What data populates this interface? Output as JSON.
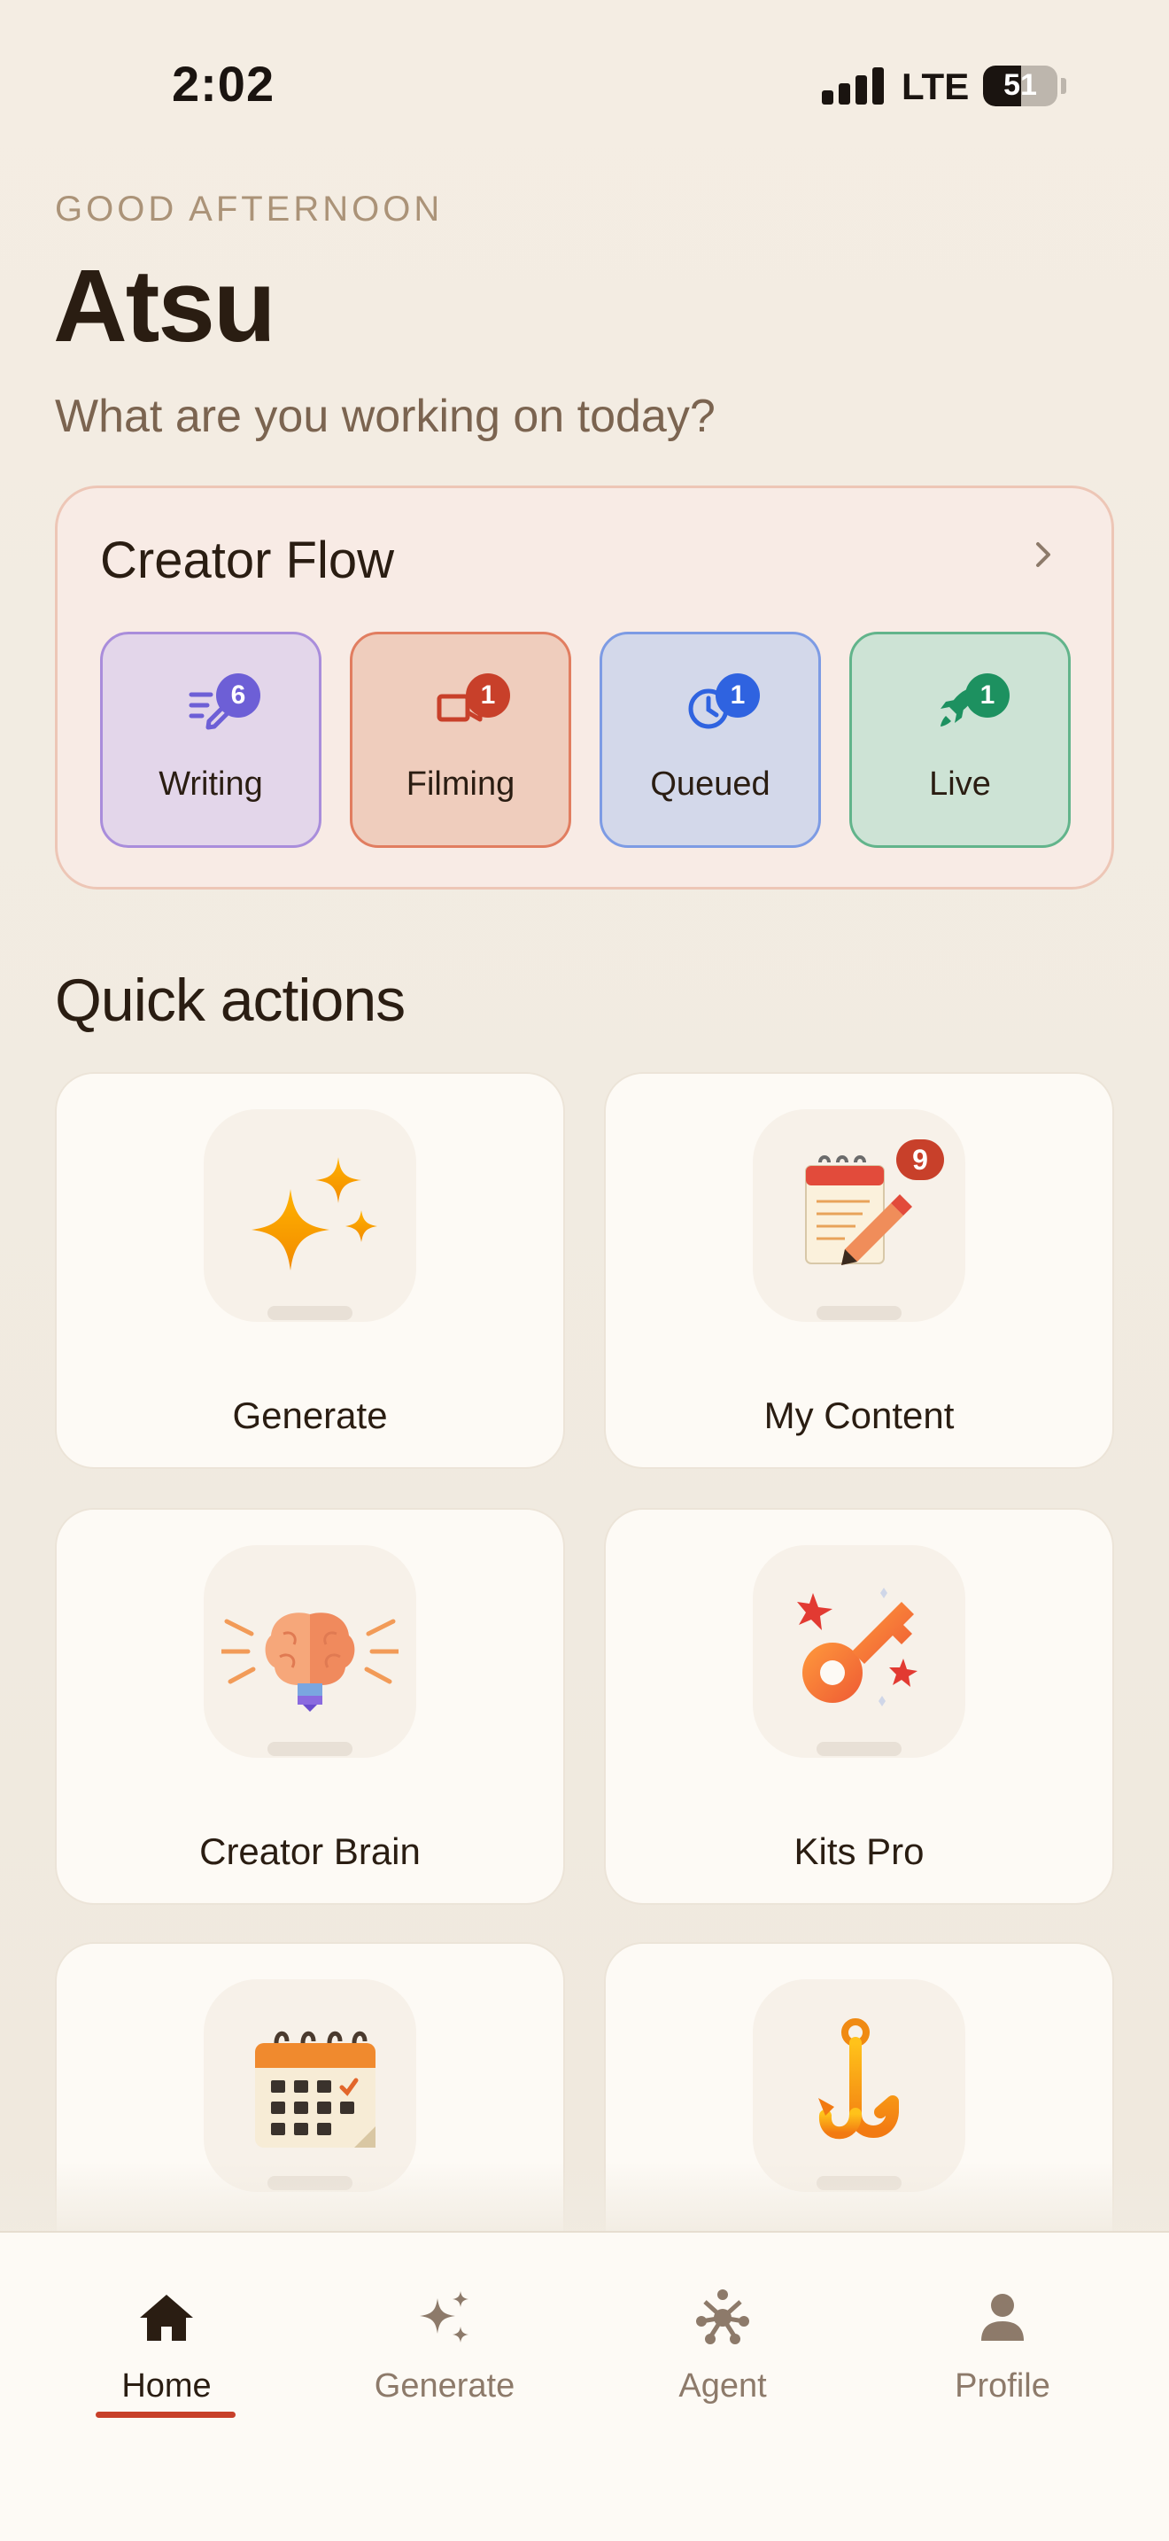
{
  "status_bar": {
    "time": "2:02",
    "network": "LTE",
    "battery_percent": "51",
    "battery_level": 0.51
  },
  "header": {
    "eyebrow": "GOOD AFTERNOON",
    "name": "Atsu",
    "subtitle": "What are you working on today?"
  },
  "creator_flow": {
    "title": "Creator Flow",
    "stages": [
      {
        "label": "Writing",
        "count": "6",
        "icon": "writing-icon",
        "bg": "#e3d6ea",
        "border": "#a98ddb",
        "accent": "#6d5fd6"
      },
      {
        "label": "Filming",
        "count": "1",
        "icon": "video-camera-icon",
        "bg": "#efcdbd",
        "border": "#e17d60",
        "accent": "#c8402a"
      },
      {
        "label": "Queued",
        "count": "1",
        "icon": "clock-icon",
        "bg": "#d3d8ea",
        "border": "#7d9be4",
        "accent": "#2f63e0"
      },
      {
        "label": "Live",
        "count": "1",
        "icon": "rocket-icon",
        "bg": "#cde3d5",
        "border": "#62b48b",
        "accent": "#1d9160"
      }
    ]
  },
  "quick_actions": {
    "heading": "Quick actions",
    "items": [
      {
        "label": "Generate",
        "icon": "sparkles-icon"
      },
      {
        "label": "My Content",
        "icon": "notepad-pencil-icon",
        "badge": "9"
      },
      {
        "label": "Creator Brain",
        "icon": "brain-lightbulb-icon"
      },
      {
        "label": "Kits Pro",
        "icon": "key-icon"
      },
      {
        "label": "",
        "icon": "calendar-icon"
      },
      {
        "label": "",
        "icon": "hook-icon"
      }
    ]
  },
  "bottom_nav": {
    "items": [
      {
        "label": "Home",
        "icon": "home-icon",
        "active": true
      },
      {
        "label": "Generate",
        "icon": "sparkles-icon",
        "active": false
      },
      {
        "label": "Agent",
        "icon": "network-icon",
        "active": false
      },
      {
        "label": "Profile",
        "icon": "person-icon",
        "active": false
      }
    ]
  },
  "colors": {
    "accent": "#c8402a",
    "text_primary": "#2a1d12",
    "text_muted": "#8d7a6a",
    "background": "#f2ebe1"
  }
}
